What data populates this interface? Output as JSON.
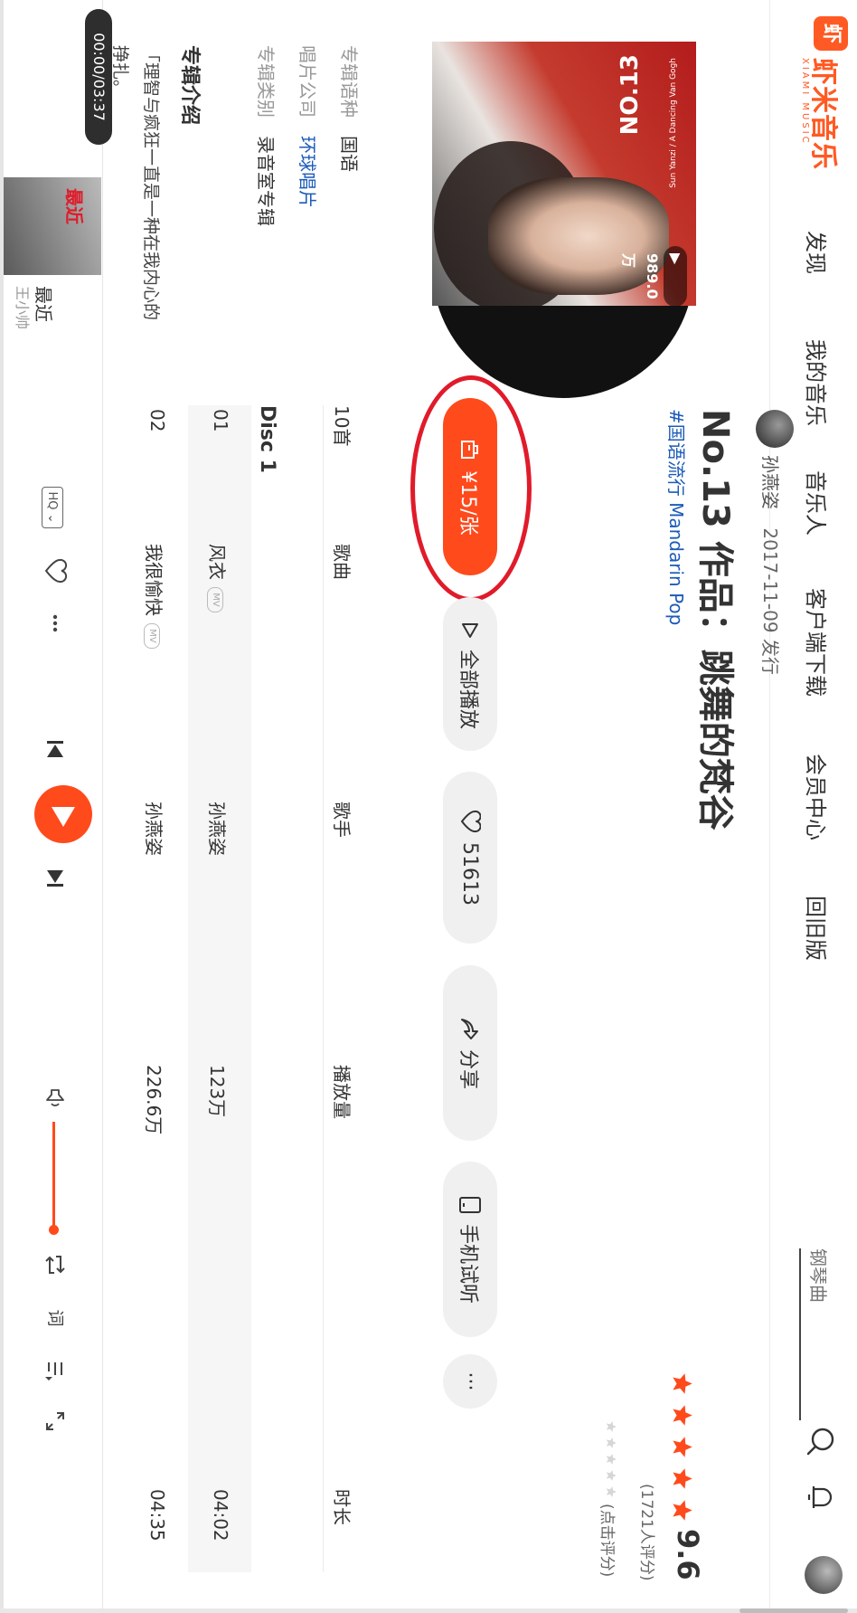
{
  "brand": {
    "name": "虾米音乐",
    "sub": "XIAMI MUSIC",
    "accent": "#ff4a1c"
  },
  "nav": [
    "发现",
    "我的音乐",
    "音乐人",
    "客户端下载",
    "会员中心",
    "回旧版"
  ],
  "search": {
    "placeholder": "钢琴曲"
  },
  "album": {
    "artist": "孙燕姿",
    "release": "2017-11-09 发行",
    "title": "No.13 作品：跳舞的梵谷",
    "tag": "#国语流行 Mandarin Pop",
    "play_count": "▶ 989.0万",
    "cover_text": "NO.13",
    "cover_small": "Sun Yanzi / A Dancing Van Gogh"
  },
  "rating": {
    "score": "9.6",
    "count": "(1721人评分)",
    "rate_hint": "(点击评分)",
    "stars_filled": 5
  },
  "actions": {
    "buy": "¥15/张",
    "play_all": "全部播放",
    "favorite_count": "51613",
    "share": "分享",
    "mobile_listen": "手机试听",
    "more": "···"
  },
  "meta": {
    "language_label": "专辑语种",
    "language": "国语",
    "company_label": "唱片公司",
    "company": "环球唱片",
    "category_label": "专辑类别",
    "category": "录音室专辑"
  },
  "intro": {
    "title": "专辑介绍",
    "text": "「理智与疯狂一直是一种在我内心的挣扎。"
  },
  "table": {
    "count": "10首",
    "headers": {
      "song": "歌曲",
      "singer": "歌手",
      "plays": "播放量",
      "duration": "时长"
    },
    "disc": "Disc 1",
    "rows": [
      {
        "num": "01",
        "title": "风衣",
        "mv": "MV",
        "singer": "孙燕姿",
        "plays": "123万",
        "duration": "04:02"
      },
      {
        "num": "02",
        "title": "我很愉快",
        "mv": "MV",
        "singer": "孙燕姿",
        "plays": "226.6万",
        "duration": "04:35"
      }
    ]
  },
  "player": {
    "time": "00:00/03:37",
    "now_title": "最近",
    "now_artist": "王小帅",
    "cover_word": "最近",
    "quality": "HQ ⌄",
    "lyrics_label": "词",
    "volume": 1.0
  }
}
